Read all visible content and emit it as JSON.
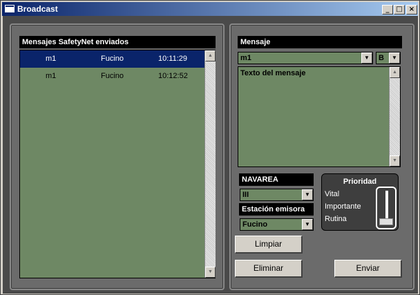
{
  "window": {
    "title": "Broadcast",
    "minimize": "_",
    "maximize": "□",
    "close": "×"
  },
  "left": {
    "header": "Mensajes SafetyNet enviados",
    "rows": [
      {
        "id": "m1",
        "station": "Fucino",
        "time": "10:11:29"
      },
      {
        "id": "m1",
        "station": "Fucino",
        "time": "10:12:52"
      }
    ]
  },
  "right": {
    "header": "Mensaje",
    "message_select": "m1",
    "format_select": "B",
    "message_text": "Texto del mensaje",
    "navarea_label": "NAVAREA",
    "navarea_value": "III",
    "station_label": "Estación emisora",
    "station_value": "Fucino",
    "priority": {
      "title": "Prioridad",
      "options": [
        "Vital",
        "Importante",
        "Rutina"
      ],
      "selected": "Rutina"
    },
    "buttons": {
      "clear": "Limpiar",
      "delete": "Eliminar",
      "send": "Enviar"
    }
  },
  "icons": {
    "up": "▲",
    "down": "▼"
  }
}
